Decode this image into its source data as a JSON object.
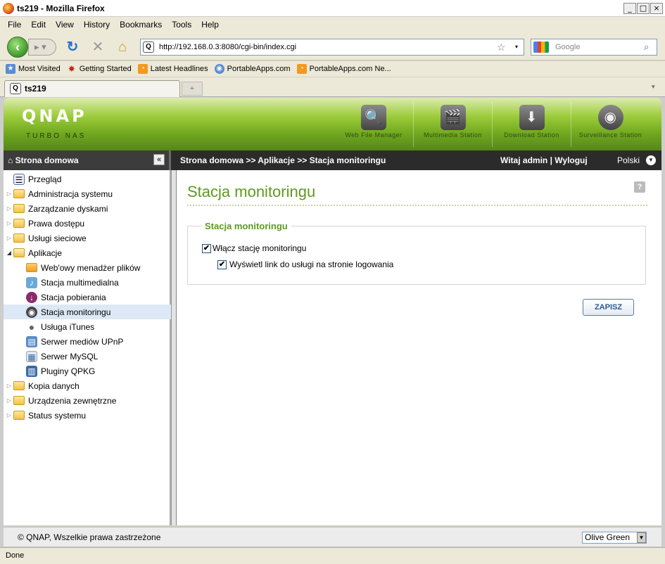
{
  "window": {
    "title": "ts219 - Mozilla Firefox"
  },
  "menu": [
    "File",
    "Edit",
    "View",
    "History",
    "Bookmarks",
    "Tools",
    "Help"
  ],
  "nav": {
    "url": "http://192.168.0.3:8080/cgi-bin/index.cgi",
    "search_placeholder": "Google"
  },
  "bookmarks": [
    "Most Visited",
    "Getting Started",
    "Latest Headlines",
    "PortableApps.com",
    "PortableApps.com Ne..."
  ],
  "tab": {
    "label": "ts219",
    "new_tab": "+"
  },
  "banner": {
    "logo": "QNAP",
    "subtitle": "TURBO NAS",
    "apps": [
      "Web File Manager",
      "Multimedia Station",
      "Download Station",
      "Surveillance Station"
    ]
  },
  "topbar": {
    "home": "Strona domowa",
    "breadcrumb": "Strona domowa >> Aplikacje >> Stacja monitoringu",
    "welcome": "Witaj admin",
    "separator": "|",
    "logout": "Wyloguj",
    "language": "Polski"
  },
  "sidebar": [
    {
      "label": "Przegląd",
      "icon": "overview-icon"
    },
    {
      "label": "Administracja systemu",
      "icon": "folder-icon"
    },
    {
      "label": "Zarządzanie dyskami",
      "icon": "folder-icon"
    },
    {
      "label": "Prawa dostępu",
      "icon": "folder-icon"
    },
    {
      "label": "Usługi sieciowe",
      "icon": "folder-icon"
    },
    {
      "label": "Aplikacje",
      "icon": "folder-open-icon"
    },
    {
      "label": "Web'owy menadżer plików",
      "icon": "file-manager-icon"
    },
    {
      "label": "Stacja multimedialna",
      "icon": "multimedia-icon"
    },
    {
      "label": "Stacja pobierania",
      "icon": "download-icon"
    },
    {
      "label": "Stacja monitoringu",
      "icon": "camera-icon"
    },
    {
      "label": "Usługa iTunes",
      "icon": "apple-icon"
    },
    {
      "label": "Serwer mediów UPnP",
      "icon": "upnp-icon"
    },
    {
      "label": "Serwer MySQL",
      "icon": "mysql-icon"
    },
    {
      "label": "Pluginy QPKG",
      "icon": "qpkg-icon"
    },
    {
      "label": "Kopia danych",
      "icon": "folder-icon"
    },
    {
      "label": "Urządzenia zewnętrzne",
      "icon": "folder-icon"
    },
    {
      "label": "Status systemu",
      "icon": "folder-icon"
    }
  ],
  "main": {
    "title": "Stacja monitoringu",
    "help": "?",
    "section": "Stacja monitoringu",
    "opt_enable": "Włącz stację monitoringu",
    "opt_enable_checked": true,
    "opt_link": "Wyświetl link do usługi na stronie logowania",
    "opt_link_checked": true,
    "save": "ZAPISZ"
  },
  "footer": {
    "copyright": "© QNAP, Wszelkie prawa zastrzeżone",
    "theme": "Olive Green"
  },
  "status": "Done",
  "colors": {
    "accent": "#5d9b1d",
    "dark_bar": "#2b2b2b"
  }
}
